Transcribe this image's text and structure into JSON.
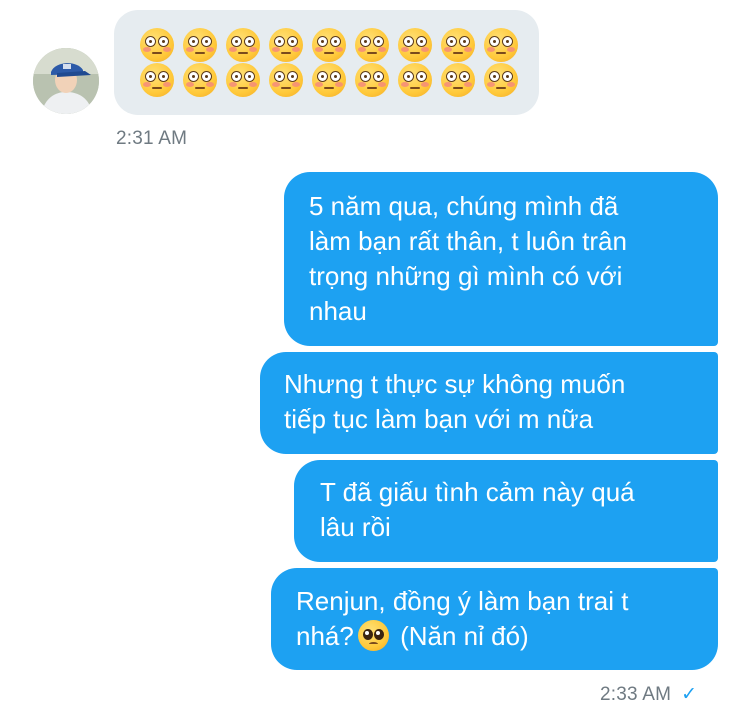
{
  "conversation": {
    "incoming_message": {
      "emoji": "flushed-face",
      "emoji_rows": 2,
      "emoji_per_row": 9,
      "timestamp": "2:31 AM"
    },
    "outgoing_messages": [
      {
        "lines": [
          "5 năm qua, chúng mình đã",
          "làm bạn rất thân, t luôn trân",
          "trọng những gì mình có với",
          "nhau"
        ]
      },
      {
        "lines": [
          "Nhưng t thực sự không muốn",
          "tiếp tục làm bạn với m nữa"
        ]
      },
      {
        "lines": [
          "T đã giấu tình cảm này quá",
          "lâu rồi"
        ]
      },
      {
        "line1": "Renjun, đồng ý làm bạn trai t",
        "line2_before": "nhá?",
        "emoji": "pleading-face",
        "line2_after": "(Năn nỉ đó)"
      }
    ],
    "outgoing_timestamp": "2:33 AM",
    "read_receipt": "✓"
  },
  "colors": {
    "outgoing_bubble": "#1da1f2",
    "incoming_bubble": "#e6ecf0",
    "timestamp_text": "#6f7a82",
    "checkmark": "#1da1f2"
  }
}
